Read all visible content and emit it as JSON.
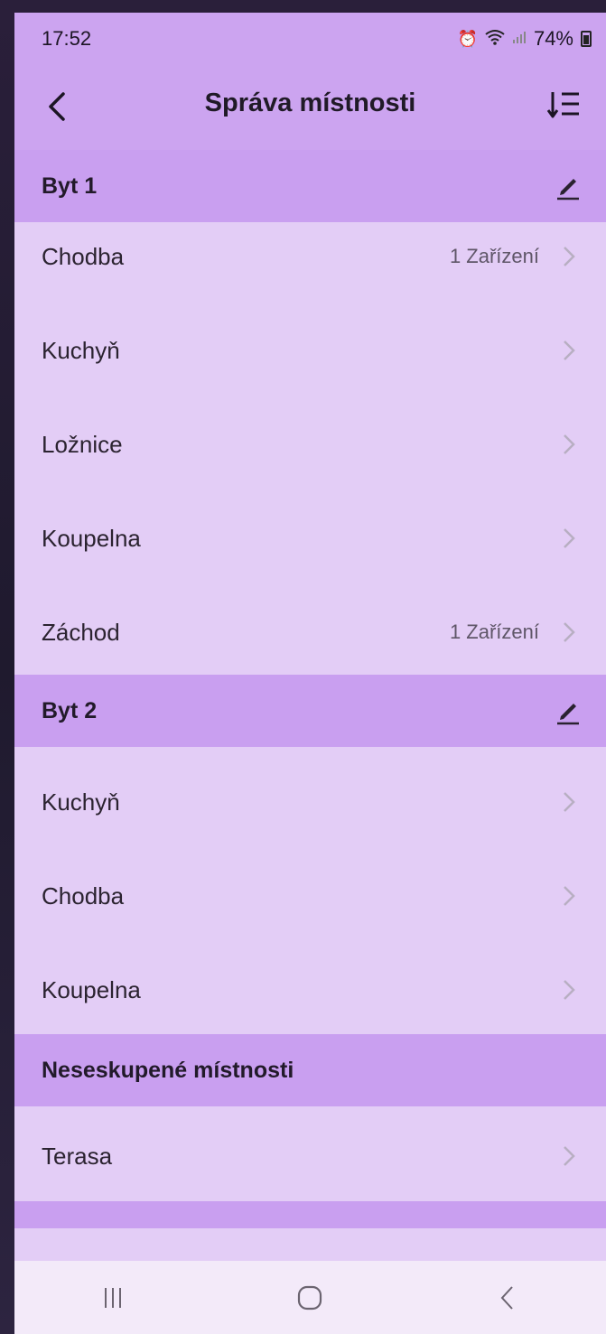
{
  "status": {
    "time": "17:52",
    "battery": "74%"
  },
  "header": {
    "title": "Správa místnosti"
  },
  "sections": [
    {
      "title": "Byt 1",
      "rooms": [
        {
          "name": "Chodba",
          "meta": "1 Zařízení"
        },
        {
          "name": "Kuchyň",
          "meta": ""
        },
        {
          "name": "Ložnice",
          "meta": ""
        },
        {
          "name": "Koupelna",
          "meta": ""
        },
        {
          "name": "Záchod",
          "meta": "1 Zařízení"
        }
      ]
    },
    {
      "title": "Byt 2",
      "rooms": [
        {
          "name": "Kuchyň",
          "meta": ""
        },
        {
          "name": "Chodba",
          "meta": ""
        },
        {
          "name": "Koupelna",
          "meta": ""
        }
      ]
    },
    {
      "title": "Neseskupené místnosti",
      "rooms": [
        {
          "name": "Terasa",
          "meta": ""
        }
      ]
    }
  ],
  "icons": {
    "back": "back-arrow-icon",
    "sort": "sort-list-icon",
    "edit": "pencil-icon",
    "chevron": "chevron-right-icon",
    "nav_recents": "recents-icon",
    "nav_home": "home-icon",
    "nav_back": "nav-back-icon"
  },
  "colors": {
    "header_bg": "#cca4f0",
    "section_bg": "#c99ff0",
    "row_bg": "#e3cdf6",
    "text": "#2b2330"
  }
}
